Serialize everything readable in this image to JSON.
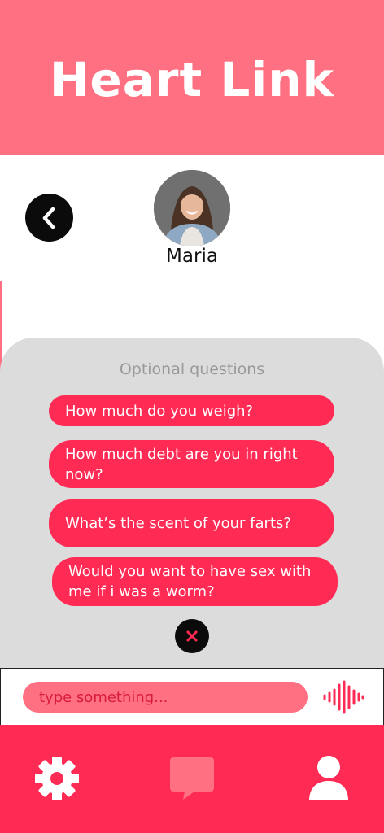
{
  "app": {
    "title": "Heart Link"
  },
  "profile": {
    "name": "Maria",
    "back_icon": "chevron-left-icon",
    "avatar": "profile-photo"
  },
  "questions": {
    "title": "Optional questions",
    "items": [
      {
        "label": "How much do you weigh?"
      },
      {
        "label": "How much debt are you in right now?"
      },
      {
        "label": "What’s the scent of your farts?"
      },
      {
        "label": "Would you want to have sex with me if i was a worm?"
      }
    ],
    "close_icon": "close-icon"
  },
  "composer": {
    "placeholder": "type something...",
    "voice_icon": "voice-wave-icon"
  },
  "nav": {
    "items": [
      {
        "icon": "gear-icon"
      },
      {
        "icon": "chat-bubble-icon"
      },
      {
        "icon": "user-icon"
      }
    ]
  },
  "colors": {
    "header": "#ff7182",
    "accent": "#ff2b55",
    "sheet": "#dcdcdc",
    "input": "#ff7182"
  }
}
